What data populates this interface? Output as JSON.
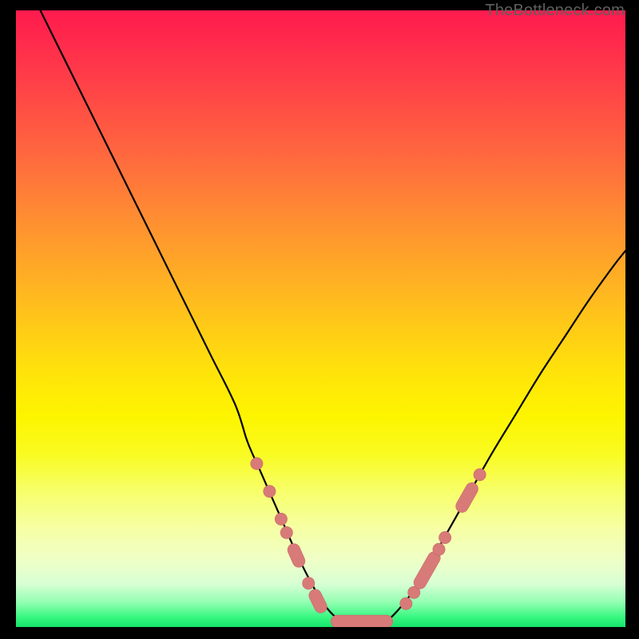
{
  "watermark": "TheBottleneck.com",
  "colors": {
    "background": "#000000",
    "curve": "#000000",
    "marker_fill": "#d87a78",
    "marker_stroke": "#c46866"
  },
  "chart_data": {
    "type": "line",
    "title": "",
    "xlabel": "",
    "ylabel": "",
    "xlim": [
      0,
      100
    ],
    "ylim": [
      0,
      100
    ],
    "grid": false,
    "legend": false,
    "series": [
      {
        "name": "bottleneck-curve",
        "x": [
          4,
          8,
          12,
          16,
          20,
          24,
          28,
          32,
          36,
          38,
          40,
          42,
          44,
          46,
          48,
          50,
          52,
          54,
          56,
          58,
          60,
          62,
          66,
          70,
          74,
          78,
          82,
          86,
          90,
          94,
          98,
          100
        ],
        "values": [
          100,
          92,
          84,
          76,
          68,
          60,
          52,
          44,
          36,
          30,
          25.5,
          21,
          16.5,
          12,
          8,
          4.5,
          2,
          0.8,
          0.4,
          0.4,
          0.8,
          2,
          7,
          14,
          21,
          28,
          34.5,
          41,
          47,
          53,
          58.5,
          61
        ]
      }
    ],
    "markers": [
      {
        "shape": "circle",
        "x": 39.5,
        "y": 26.5,
        "r": 1.0
      },
      {
        "shape": "circle",
        "x": 41.6,
        "y": 22.0,
        "r": 1.0
      },
      {
        "shape": "circle",
        "x": 43.5,
        "y": 17.5,
        "r": 1.0
      },
      {
        "shape": "circle",
        "x": 44.4,
        "y": 15.3,
        "r": 1.0
      },
      {
        "shape": "capsule",
        "x1": 45.6,
        "y1": 12.5,
        "x2": 46.4,
        "y2": 10.7,
        "r": 1.0
      },
      {
        "shape": "circle",
        "x": 48.0,
        "y": 7.1,
        "r": 1.0
      },
      {
        "shape": "capsule",
        "x1": 49.1,
        "y1": 5.1,
        "x2": 50.0,
        "y2": 3.3,
        "r": 1.0
      },
      {
        "shape": "capsule",
        "x1": 52.7,
        "y1": 0.9,
        "x2": 60.8,
        "y2": 0.9,
        "r": 1.0
      },
      {
        "shape": "circle",
        "x": 64.0,
        "y": 3.8,
        "r": 1.0
      },
      {
        "shape": "circle",
        "x": 65.3,
        "y": 5.6,
        "r": 1.0
      },
      {
        "shape": "capsule",
        "x1": 66.3,
        "y1": 7.2,
        "x2": 68.6,
        "y2": 11.2,
        "r": 1.0
      },
      {
        "shape": "circle",
        "x": 69.4,
        "y": 12.6,
        "r": 1.0
      },
      {
        "shape": "circle",
        "x": 70.4,
        "y": 14.5,
        "r": 1.0
      },
      {
        "shape": "capsule",
        "x1": 73.2,
        "y1": 19.6,
        "x2": 74.8,
        "y2": 22.4,
        "r": 1.0
      },
      {
        "shape": "circle",
        "x": 76.1,
        "y": 24.7,
        "r": 1.0
      }
    ]
  }
}
